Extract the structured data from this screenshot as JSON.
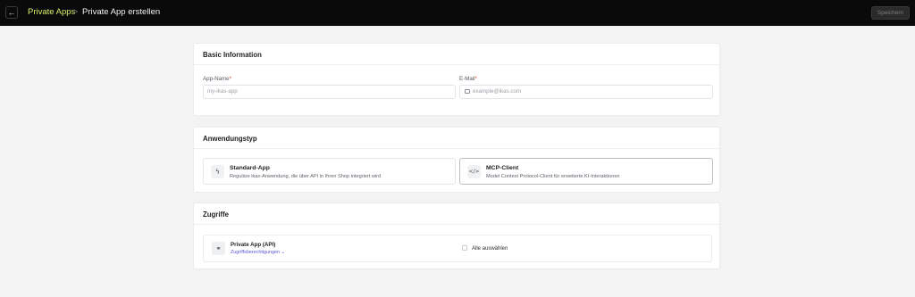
{
  "topbar": {
    "back_icon": "arrow-left-icon",
    "back_glyph": "←",
    "breadcrumb_parent": "Private Apps",
    "breadcrumb_separator": ">",
    "breadcrumb_current": "Private App erstellen",
    "save_label": "Speichern"
  },
  "basic_info": {
    "title": "Basic Information",
    "app_name_label": "App-Name",
    "app_name_placeholder": "my-ikas-app",
    "email_label": "E-Mail",
    "email_placeholder": "example@ikas.com",
    "required_marker": "*"
  },
  "app_type": {
    "title": "Anwendungstyp",
    "options": [
      {
        "icon": "lightning-icon",
        "glyph": "ϟ",
        "title": "Standard-App",
        "description": "Reguläre ikas-Anwendung, die über API in Ihren Shop integriert wird",
        "selected": false
      },
      {
        "icon": "code-icon",
        "glyph": "</>",
        "title": "MCP-Client",
        "description": "Model Context Protocol-Client für erweiterte KI-Interaktionen",
        "selected": true
      }
    ]
  },
  "access": {
    "title": "Zugriffe",
    "item_title": "Private App (API)",
    "item_icon": "link-icon",
    "item_glyph": "⚭",
    "permissions_link": "Zugriffsberechtigungen",
    "permissions_chevron": "⌄",
    "select_all_label": "Alle auswählen"
  },
  "colors": {
    "topbar_bg": "#0a0a0a",
    "breadcrumb_accent": "#d6ef6a",
    "link_color": "#5b55d6",
    "required_color": "#e0453b"
  }
}
